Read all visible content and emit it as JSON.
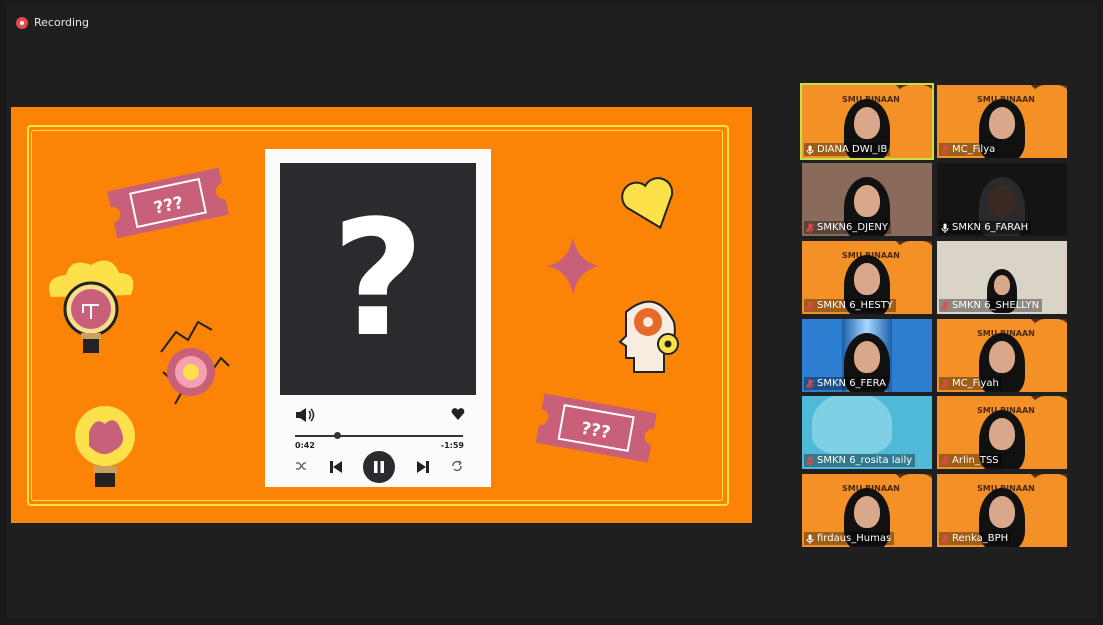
{
  "recording": {
    "label": "Recording"
  },
  "player": {
    "cover_glyph": "?",
    "time_elapsed": "0:42",
    "time_remaining": "-1:59",
    "progress_fraction": 0.25
  },
  "tickets": [
    "???",
    "???"
  ],
  "participants": [
    {
      "name": "DIANA DWI_IB",
      "muted": false,
      "active": true,
      "bg": "slide"
    },
    {
      "name": "MC_Filya",
      "muted": true,
      "active": false,
      "bg": "slide"
    },
    {
      "name": "SMKN6_DJENY",
      "muted": true,
      "active": false,
      "bg": "room"
    },
    {
      "name": "SMKN 6_FARAH",
      "muted": false,
      "active": false,
      "bg": "dark"
    },
    {
      "name": "SMKN 6_HESTY",
      "muted": true,
      "active": false,
      "bg": "slide"
    },
    {
      "name": "SMKN 6_SHELLYN",
      "muted": true,
      "active": false,
      "bg": "wall"
    },
    {
      "name": "SMKN 6_FERA",
      "muted": true,
      "active": false,
      "bg": "blue"
    },
    {
      "name": "MC_Fiyah",
      "muted": true,
      "active": false,
      "bg": "slide"
    },
    {
      "name": "SMKN 6_rosita laily",
      "muted": true,
      "active": false,
      "bg": "cyan"
    },
    {
      "name": "Arlin_TSS",
      "muted": true,
      "active": false,
      "bg": "slide"
    },
    {
      "name": "firdaus_Humas",
      "muted": false,
      "active": false,
      "bg": "slide"
    },
    {
      "name": "Renka_BPH",
      "muted": true,
      "active": false,
      "bg": "slide"
    }
  ],
  "slide_title": "SMU BINAAN",
  "colors": {
    "accent": "#fb8406",
    "frame": "#fde14a",
    "active_border": "#c8e04a",
    "muted_mic": "#e5484d"
  }
}
